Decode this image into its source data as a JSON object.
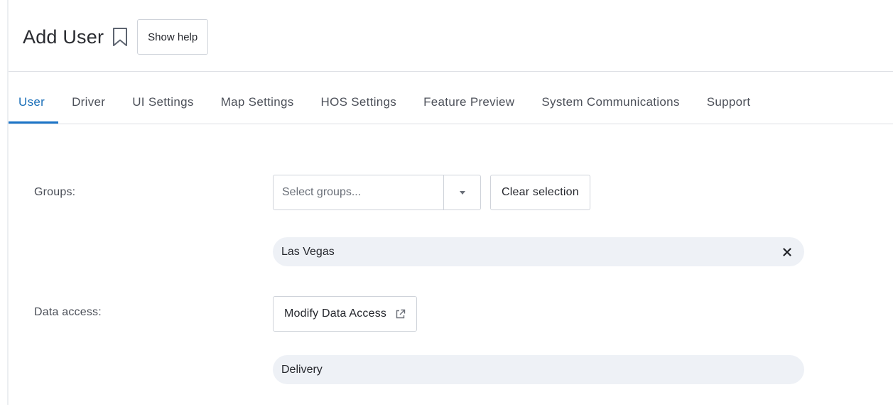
{
  "header": {
    "title": "Add User",
    "help_label": "Show help"
  },
  "tabs": [
    {
      "label": "User",
      "active": true
    },
    {
      "label": "Driver",
      "active": false
    },
    {
      "label": "UI Settings",
      "active": false
    },
    {
      "label": "Map Settings",
      "active": false
    },
    {
      "label": "HOS Settings",
      "active": false
    },
    {
      "label": "Feature Preview",
      "active": false
    },
    {
      "label": "System Communications",
      "active": false
    },
    {
      "label": "Support",
      "active": false
    }
  ],
  "groups": {
    "label": "Groups:",
    "placeholder": "Select groups...",
    "clear_label": "Clear selection",
    "selected": [
      "Las Vegas"
    ]
  },
  "data_access": {
    "label": "Data access:",
    "modify_label": "Modify Data Access",
    "items": [
      "Delivery"
    ]
  },
  "colors": {
    "accent": "#1b74c7",
    "chip_background": "#eef1f6"
  },
  "icons": {
    "bookmark": "bookmark-icon",
    "dropdown": "chevron-down-icon",
    "external": "external-link-icon",
    "remove": "close-icon"
  }
}
